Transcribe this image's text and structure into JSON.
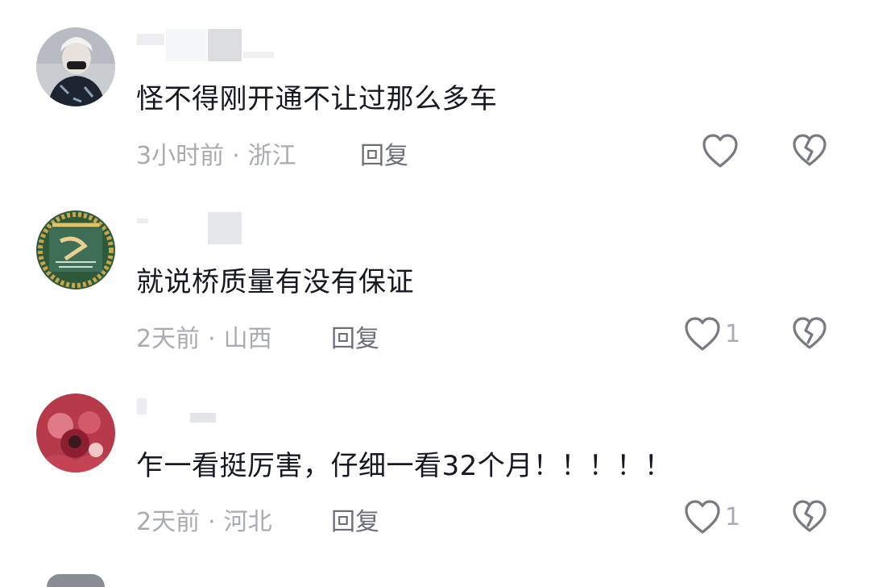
{
  "reply_label": "回复",
  "dot": "·",
  "comments": [
    {
      "text": "怪不得刚开通不让过那么多车",
      "time": "3小时前",
      "location": "浙江",
      "likes": ""
    },
    {
      "text": "就说桥质量有没有保证",
      "time": "2天前",
      "location": "山西",
      "likes": "1"
    },
    {
      "text": "乍一看挺厉害，仔细一看32个月！！！！！",
      "time": "2天前",
      "location": "河北",
      "likes": "1"
    }
  ]
}
